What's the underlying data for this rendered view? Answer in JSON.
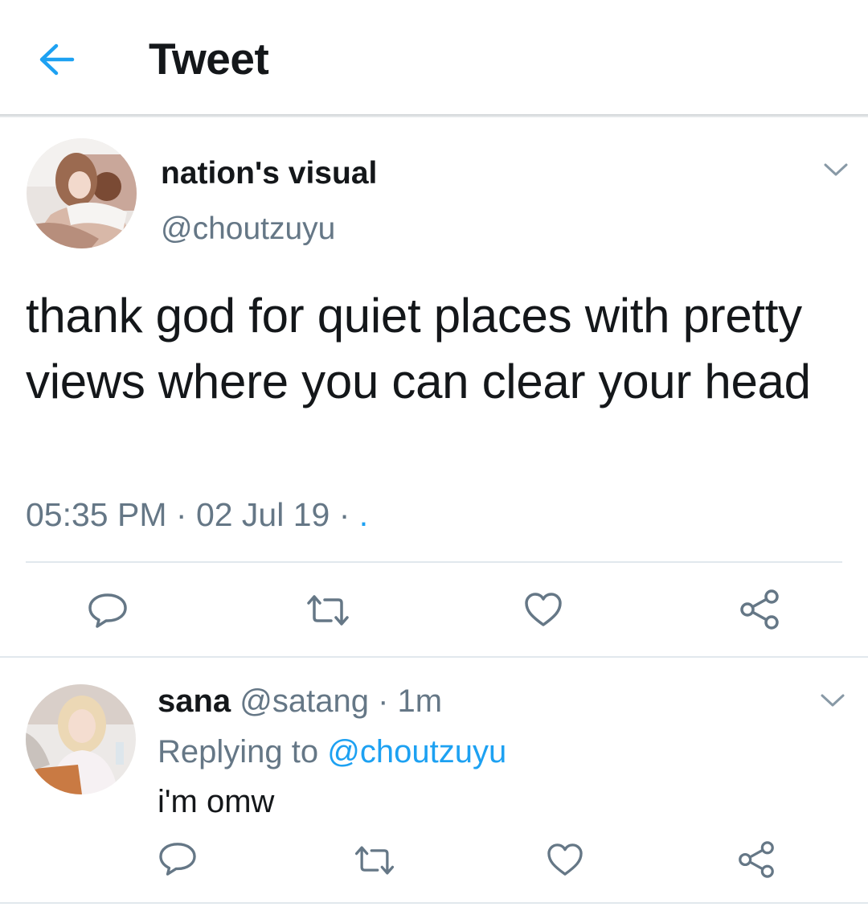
{
  "header": {
    "title": "Tweet",
    "back_icon": "arrow-left-icon",
    "accent": "#1da1f2"
  },
  "tweet": {
    "author_name": "nation's visual",
    "author_handle": "@choutzuyu",
    "text": "thank god for quiet places with pretty views where you can clear your head",
    "time": "05:35 PM",
    "date": "02 Jul 19",
    "source": ".",
    "actions": [
      "reply-icon",
      "retweet-icon",
      "like-icon",
      "share-icon"
    ]
  },
  "reply": {
    "author_name": "sana",
    "author_handle": "@satang",
    "age": "1m",
    "replying_label": "Replying to",
    "replying_to": "@choutzuyu",
    "text": "i'm omw",
    "actions": [
      "reply-icon",
      "retweet-icon",
      "like-icon",
      "share-icon"
    ]
  },
  "colors": {
    "text": "#14171a",
    "secondary": "#657786",
    "link": "#1da1f2",
    "divider": "#e1e8ed"
  }
}
